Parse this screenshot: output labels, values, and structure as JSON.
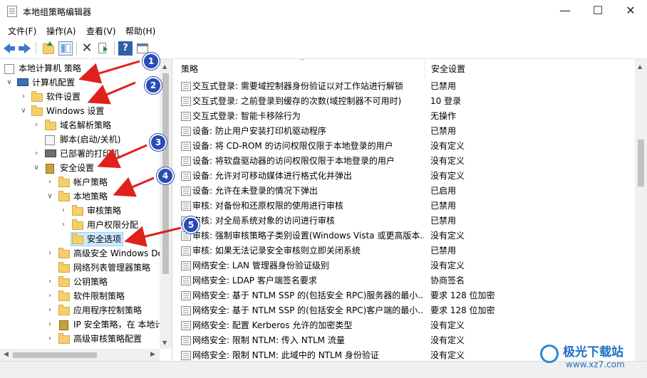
{
  "window": {
    "title": "本地组策略编辑器",
    "minimize": "—",
    "maximize": "☐",
    "close": "✕"
  },
  "menu": [
    "文件(F)",
    "操作(A)",
    "查看(V)",
    "帮助(H)"
  ],
  "tree": {
    "root": "本地计算机 策略",
    "computer_config": "计算机配置",
    "software_settings": "软件设置",
    "windows_settings": "Windows 设置",
    "dns_policy": "域名解析策略",
    "scripts": "脚本(启动/关机)",
    "printers": "已部署的打印机",
    "security_settings": "安全设置",
    "account_policy": "帐户策略",
    "local_policy": "本地策略",
    "audit_policy": "审核策略",
    "user_rights": "用户权限分配",
    "security_options": "安全选项",
    "advanced_firewall": "高级安全 Windows De",
    "network_list": "网络列表管理器策略",
    "public_key": "公钥策略",
    "software_restriction": "软件限制策略",
    "app_control": "应用程序控制策略",
    "ip_security": "IP 安全策略，在 本地计",
    "advanced_audit": "高级审核策略配置"
  },
  "columns": {
    "policy": "策略",
    "setting": "安全设置"
  },
  "rows": [
    {
      "policy": "交互式登录: 需要域控制器身份验证以对工作站进行解锁",
      "setting": "已禁用"
    },
    {
      "policy": "交互式登录: 之前登录到缓存的次数(域控制器不可用时)",
      "setting": "10 登录"
    },
    {
      "policy": "交互式登录: 智能卡移除行为",
      "setting": "无操作"
    },
    {
      "policy": "设备: 防止用户安装打印机驱动程序",
      "setting": "已禁用"
    },
    {
      "policy": "设备: 将 CD-ROM 的访问权限仅限于本地登录的用户",
      "setting": "没有定义"
    },
    {
      "policy": "设备: 将软盘驱动器的访问权限仅限于本地登录的用户",
      "setting": "没有定义"
    },
    {
      "policy": "设备: 允许对可移动媒体进行格式化并弹出",
      "setting": "没有定义"
    },
    {
      "policy": "设备: 允许在未登录的情况下弹出",
      "setting": "已启用"
    },
    {
      "policy": "审核: 对备份和还原权限的使用进行审核",
      "setting": "已禁用"
    },
    {
      "policy": "审核: 对全局系统对象的访问进行审核",
      "setting": "已禁用"
    },
    {
      "policy": "审核: 强制审核策略子类别设置(Windows Vista 或更高版本...",
      "setting": "没有定义"
    },
    {
      "policy": "审核: 如果无法记录安全审核则立即关闭系统",
      "setting": "已禁用"
    },
    {
      "policy": "网络安全: LAN 管理器身份验证级别",
      "setting": "没有定义"
    },
    {
      "policy": "网络安全: LDAP 客户端签名要求",
      "setting": "协商签名"
    },
    {
      "policy": "网络安全: 基于 NTLM SSP 的(包括安全 RPC)服务器的最小...",
      "setting": "要求 128 位加密"
    },
    {
      "policy": "网络安全: 基于 NTLM SSP 的(包括安全 RPC)客户端的最小...",
      "setting": "要求 128 位加密"
    },
    {
      "policy": "网络安全: 配置 Kerberos 允许的加密类型",
      "setting": "没有定义"
    },
    {
      "policy": "网络安全: 限制 NTLM: 传入 NTLM 流量",
      "setting": "没有定义"
    },
    {
      "policy": "网络安全: 限制 NTLM: 此域中的 NTLM 身份验证",
      "setting": "没有定义"
    }
  ],
  "callouts": [
    "1",
    "2",
    "3",
    "4",
    "5"
  ],
  "watermark": {
    "text": "极光下载站",
    "url": "www.xz7.com"
  },
  "colors": {
    "callout": "#2c4bb5",
    "arrow": "#e0201c",
    "selection": "#cce8ff"
  }
}
